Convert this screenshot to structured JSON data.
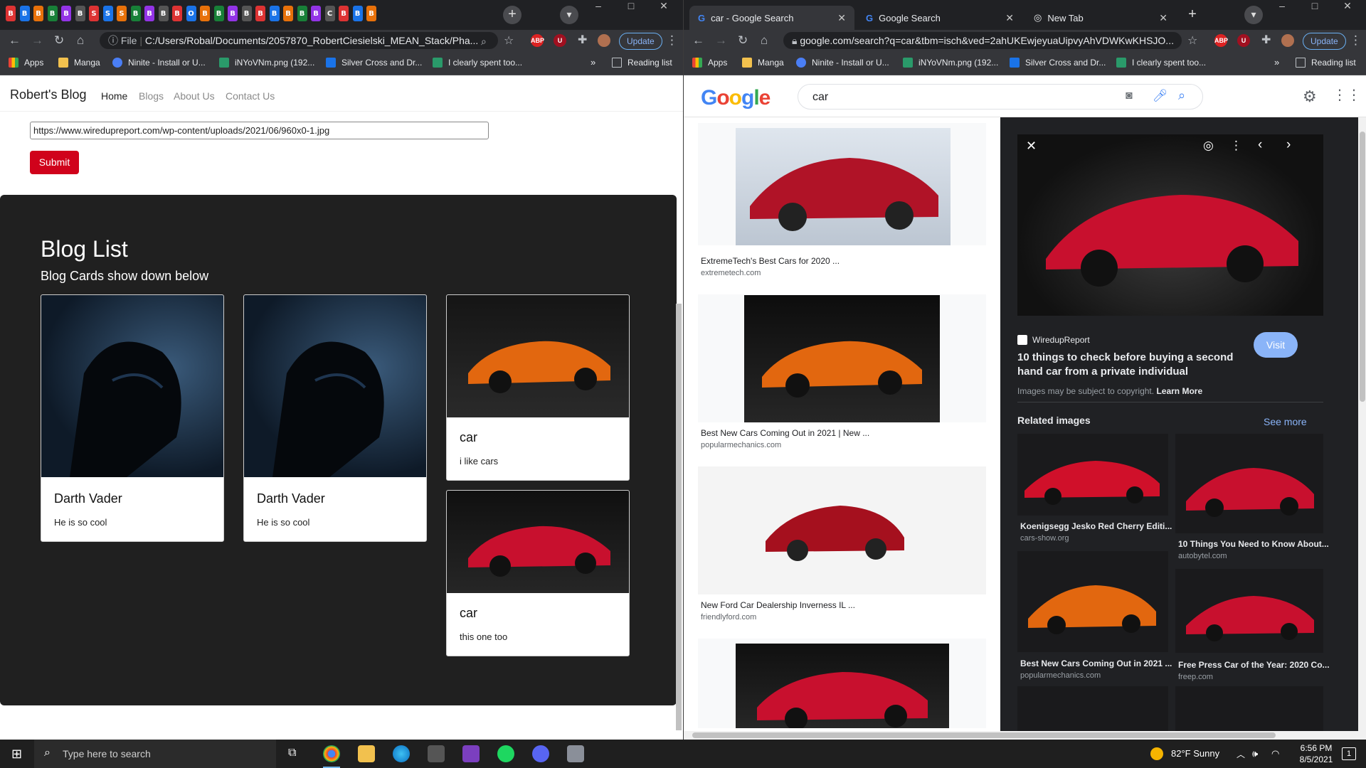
{
  "left_window": {
    "pinned_tabs": [
      "B",
      "B",
      "B",
      "B",
      "B",
      "B",
      "S",
      "S",
      "S",
      "B",
      "B",
      "B",
      "B",
      "O",
      "B",
      "B",
      "B",
      "B",
      "B",
      "B",
      "B",
      "B",
      "B",
      "C",
      "B",
      "B",
      "B"
    ],
    "toolbar": {
      "url_prefix": "File",
      "url": "C:/Users/Robal/Documents/2057870_RobertCiesielski_MEAN_Stack/Pha...",
      "update_label": "Update"
    },
    "bookmarks": [
      "Apps",
      "Manga",
      "Ninite - Install or U...",
      "iNYoVNm.png (192...",
      "Silver Cross and Dr...",
      "I clearly spent too..."
    ],
    "reading_list": "Reading list",
    "page": {
      "brand": "Robert's Blog",
      "nav": [
        "Home",
        "Blogs",
        "About Us",
        "Contact Us"
      ],
      "url_field_value": "https://www.wiredupreport.com/wp-content/uploads/2021/06/960x0-1.jpg",
      "submit_label": "Submit",
      "blog_list_title": "Blog List",
      "blog_list_subtitle": "Blog Cards show down below",
      "cards": [
        {
          "title": "Darth Vader",
          "text": "He is so cool"
        },
        {
          "title": "Darth Vader",
          "text": "He is so cool"
        },
        {
          "title": "car",
          "text": "i like cars"
        },
        {
          "title": "car",
          "text": "this one too"
        }
      ]
    }
  },
  "right_window": {
    "tabs": [
      "car - Google Search",
      "Google Search",
      "New Tab"
    ],
    "toolbar": {
      "url": "google.com/search?q=car&tbm=isch&ved=2ahUKEwjeyuaUipvyAhVDWKwKHSJO...",
      "update_label": "Update"
    },
    "bookmarks": [
      "Apps",
      "Manga",
      "Ninite - Install or U...",
      "iNYoVNm.png (192...",
      "Silver Cross and Dr...",
      "I clearly spent too..."
    ],
    "reading_list": "Reading list",
    "search": {
      "logo_letters": [
        "G",
        "o",
        "o",
        "g",
        "l",
        "e"
      ],
      "query": "car"
    },
    "results": [
      {
        "caption": "ExtremeTech's Best Cars for 2020 ...",
        "source": "extremetech.com"
      },
      {
        "caption": "Best New Cars Coming Out in 2021 | New ...",
        "source": "popularmechanics.com"
      },
      {
        "caption": "New Ford Car Dealership Inverness IL ...",
        "source": "friendlyford.com"
      }
    ],
    "panel": {
      "site": "WiredupReport",
      "title": "10 things to check before buying a second hand car from a private individual",
      "visit_label": "Visit",
      "copyright": "Images may be subject to copyright.",
      "learn_more": "Learn More",
      "related_title": "Related images",
      "see_more": "See more",
      "related": [
        {
          "caption": "Koenigsegg Jesko Red Cherry Editi...",
          "source": "cars-show.org"
        },
        {
          "caption": "10 Things You Need to Know About...",
          "source": "autobytel.com"
        },
        {
          "caption": "Best New Cars Coming Out in 2021 ...",
          "source": "popularmechanics.com"
        },
        {
          "caption": "Free Press Car of the Year: 2020 Co...",
          "source": "freep.com"
        }
      ]
    }
  },
  "taskbar": {
    "search_placeholder": "Type here to search",
    "weather": "82°F  Sunny",
    "time": "6:56 PM",
    "date": "8/5/2021",
    "notification_count": "1"
  },
  "colors": {
    "chrome_dark": "#202124",
    "toolbar": "#35363a",
    "submit_red": "#d0021b",
    "panel_dark": "#202124",
    "google_blue": "#4285f4",
    "google_red": "#ea4335",
    "google_yellow": "#fbbc05",
    "google_green": "#34a853"
  }
}
